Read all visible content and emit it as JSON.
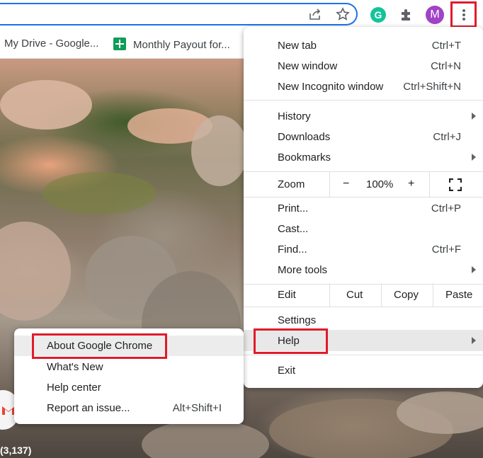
{
  "toolbar": {
    "share_icon": "share-icon",
    "star_icon": "bookmark-star-icon",
    "grammarly_letter": "G",
    "extensions_icon": "puzzle-icon",
    "profile_initial": "M",
    "menu_icon": "three-dot-menu-icon"
  },
  "bookmarks": [
    {
      "label": "My Drive - Google...",
      "icon": "google-drive-icon"
    },
    {
      "label": "Monthly Payout for...",
      "icon": "google-sheets-icon"
    }
  ],
  "menu": {
    "new_tab": {
      "label": "New tab",
      "shortcut": "Ctrl+T"
    },
    "new_window": {
      "label": "New window",
      "shortcut": "Ctrl+N"
    },
    "new_incognito": {
      "label": "New Incognito window",
      "shortcut": "Ctrl+Shift+N"
    },
    "history": {
      "label": "History"
    },
    "downloads": {
      "label": "Downloads",
      "shortcut": "Ctrl+J"
    },
    "bookmarks": {
      "label": "Bookmarks"
    },
    "zoom": {
      "label": "Zoom",
      "minus": "−",
      "value": "100%",
      "plus": "+"
    },
    "print": {
      "label": "Print...",
      "shortcut": "Ctrl+P"
    },
    "cast": {
      "label": "Cast..."
    },
    "find": {
      "label": "Find...",
      "shortcut": "Ctrl+F"
    },
    "more_tools": {
      "label": "More tools"
    },
    "edit": {
      "label": "Edit",
      "cut": "Cut",
      "copy": "Copy",
      "paste": "Paste"
    },
    "settings": {
      "label": "Settings"
    },
    "help": {
      "label": "Help"
    },
    "exit": {
      "label": "Exit"
    }
  },
  "help_submenu": {
    "about": {
      "label": "About Google Chrome"
    },
    "whats_new": {
      "label": "What's New"
    },
    "help_center": {
      "label": "Help center"
    },
    "report_issue": {
      "label": "Report an issue...",
      "shortcut": "Alt+Shift+I"
    }
  },
  "background": {
    "gmail_count": "(3,137)"
  },
  "colors": {
    "highlight": "#e01b2b",
    "accent": "#1a73e8",
    "avatar": "#a142c7"
  }
}
